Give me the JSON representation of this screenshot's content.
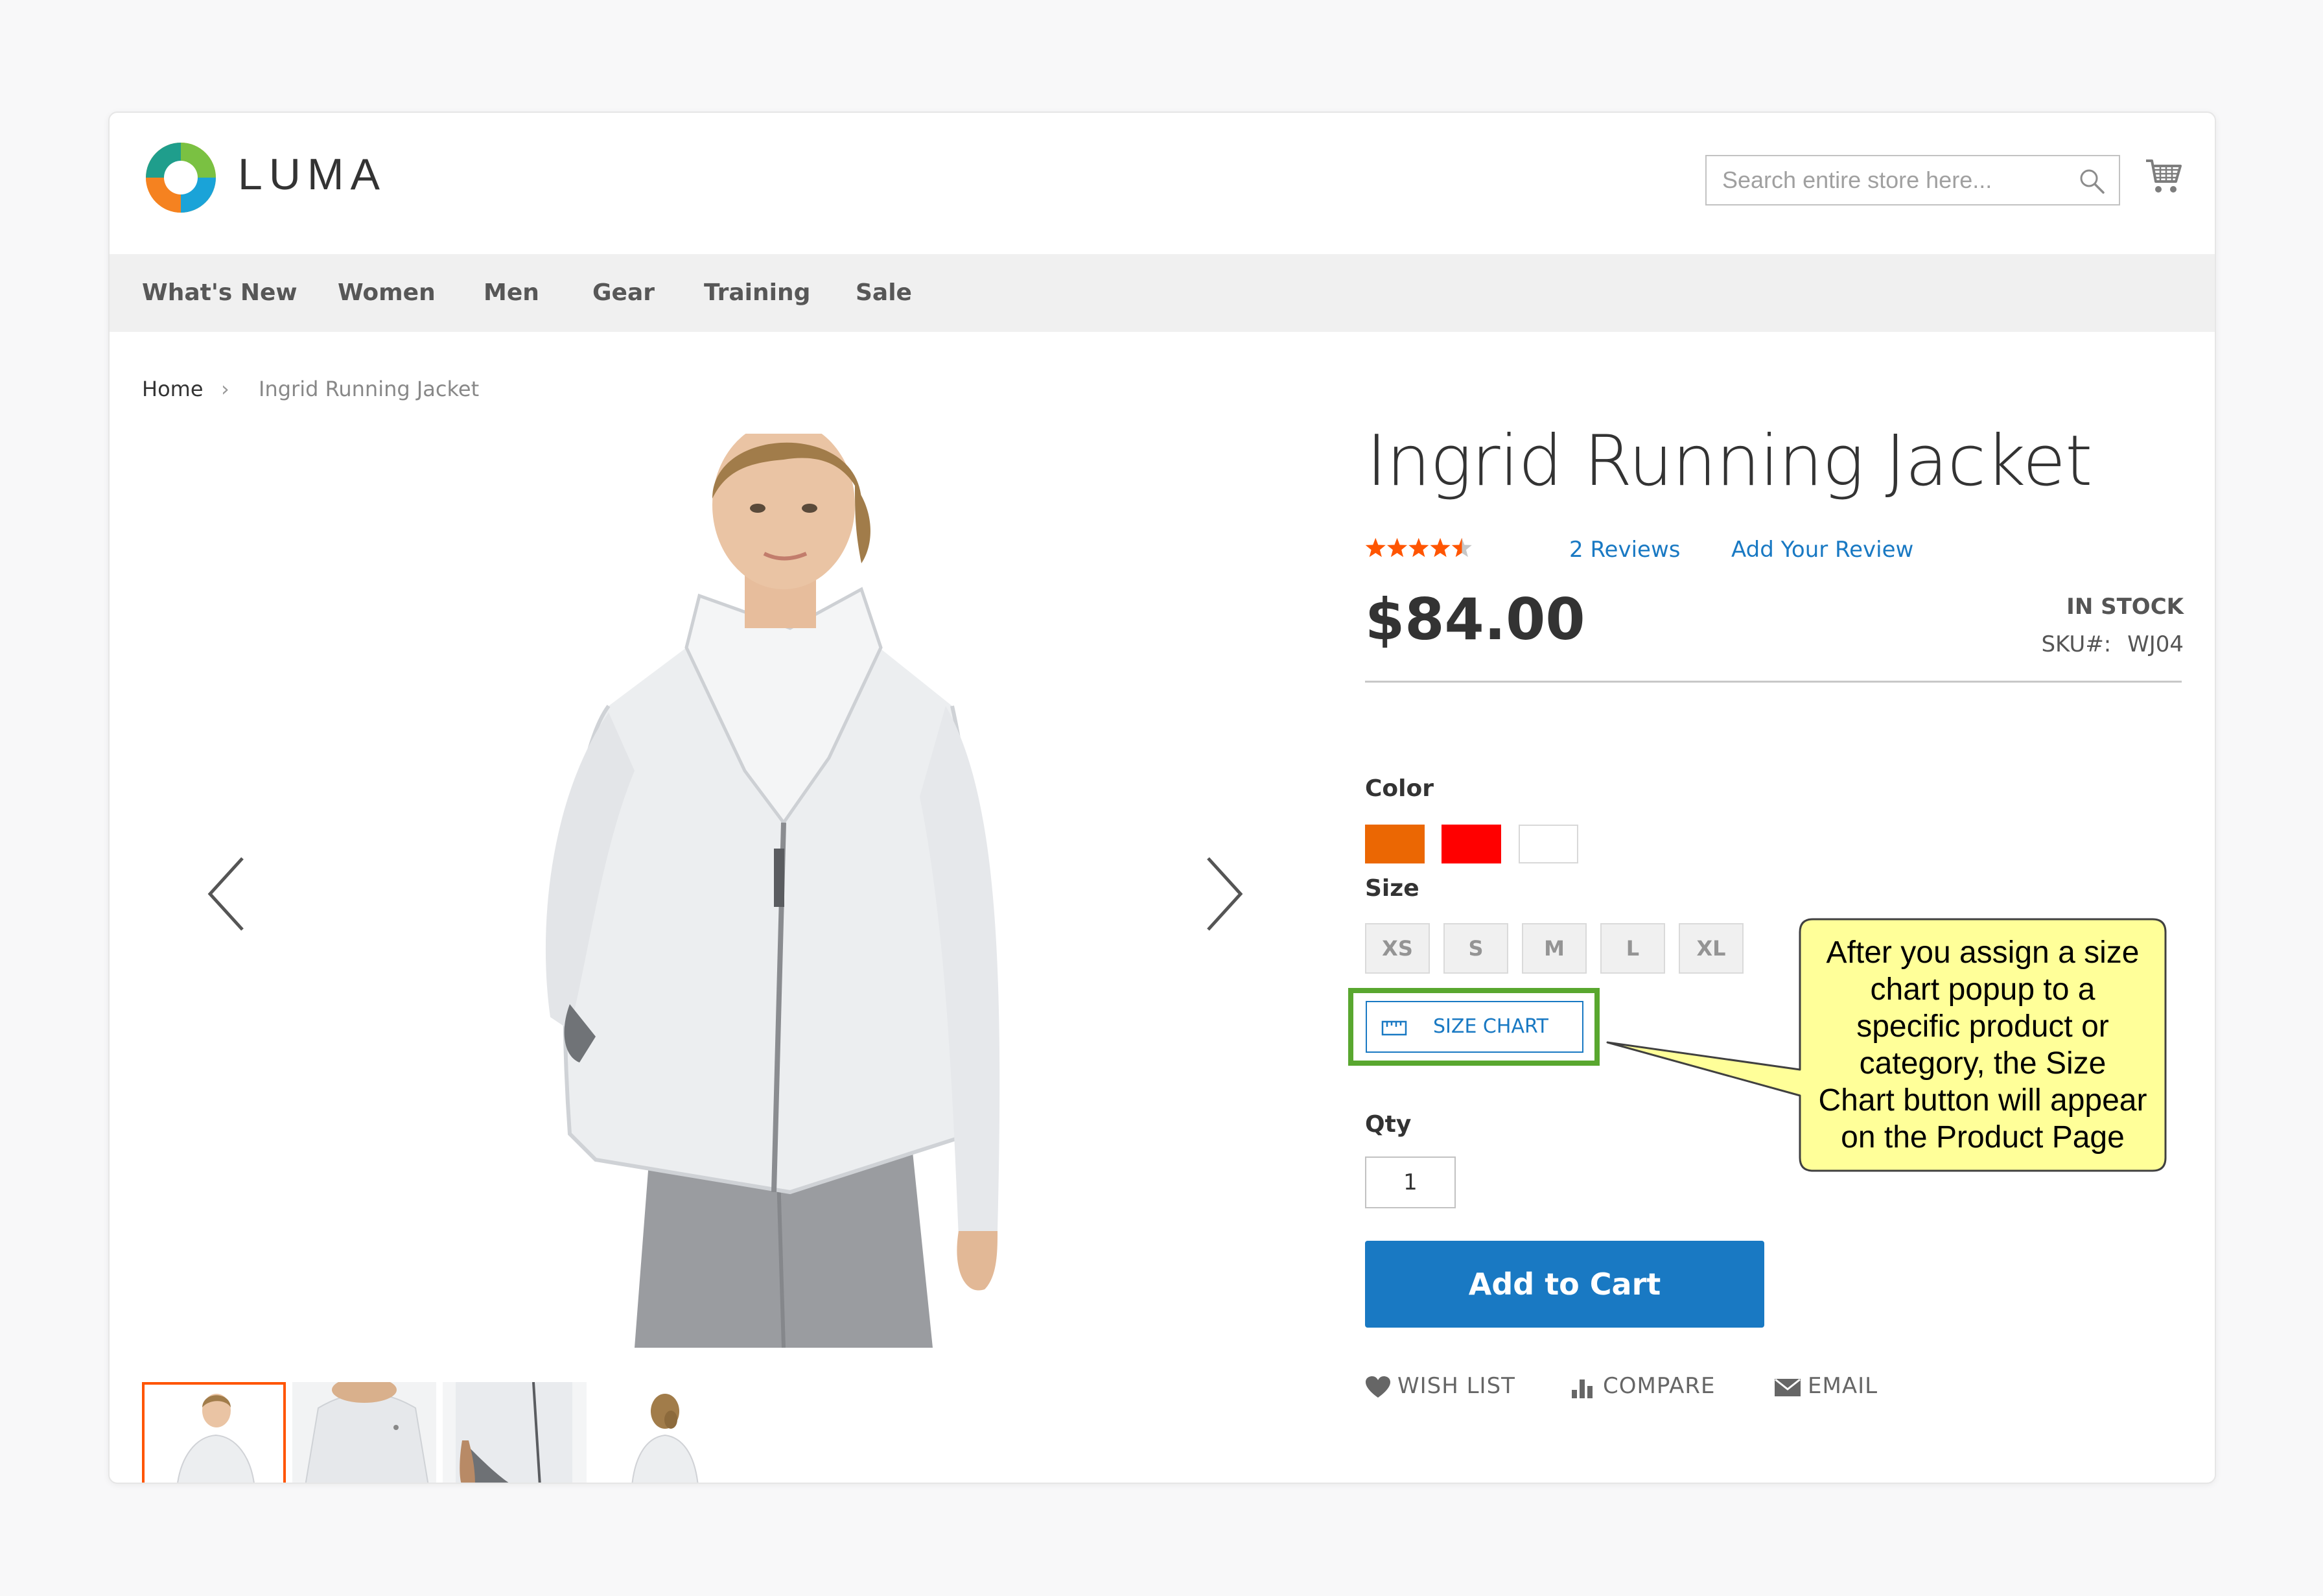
{
  "header": {
    "brand": "LUMA",
    "search_placeholder": "Search entire store here..."
  },
  "nav": {
    "items": [
      "What's New",
      "Women",
      "Men",
      "Gear",
      "Training",
      "Sale"
    ]
  },
  "breadcrumb": {
    "home": "Home",
    "separator": "›",
    "current": "Ingrid Running Jacket"
  },
  "product": {
    "title": "Ingrid Running Jacket",
    "rating_stars": 4.5,
    "reviews_link": "2 Reviews",
    "add_review_link": "Add Your Review",
    "price": "$84.00",
    "stock": "IN STOCK",
    "sku_label": "SKU#:",
    "sku": "WJ04",
    "color_label": "Color",
    "colors": [
      "#eb6703",
      "#ff0000",
      "#ffffff"
    ],
    "size_label": "Size",
    "sizes": [
      "XS",
      "S",
      "M",
      "L",
      "XL"
    ],
    "size_chart_button": "SIZE CHART",
    "qty_label": "Qty",
    "qty_value": "1",
    "add_to_cart": "Add to Cart",
    "actions": {
      "wish_list": "WISH LIST",
      "compare": "COMPARE",
      "email": "EMAIL"
    }
  },
  "callout": {
    "lines": [
      "After you assign a size",
      "chart popup to a",
      "specific product or",
      "category, the Size",
      "Chart button will appear",
      "on the Product Page"
    ],
    "fill": "#ffff99"
  },
  "theme": {
    "accent": "#1979c3",
    "highlight_border": "#59a72f",
    "star_color": "#ff5501",
    "active_thumb_border": "#ff5501"
  }
}
